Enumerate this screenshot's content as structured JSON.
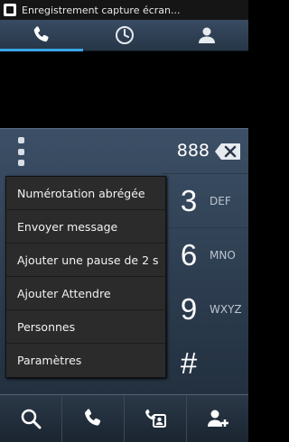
{
  "status_bar": {
    "notification_text": "Enregistrement capture écran..."
  },
  "tabs": [
    {
      "icon": "phone-icon",
      "active": true
    },
    {
      "icon": "clock-icon",
      "active": false
    },
    {
      "icon": "contact-icon",
      "active": false
    }
  ],
  "dialer": {
    "number": "888"
  },
  "menu": {
    "items": [
      "Numérotation abrégée",
      "Envoyer message",
      "Ajouter une pause de 2 s",
      "Ajouter Attendre",
      "Personnes",
      "Paramètres"
    ]
  },
  "keypad": {
    "keys": [
      {
        "num": "3",
        "letters": "DEF"
      },
      {
        "num": "6",
        "letters": "MNO"
      },
      {
        "num": "9",
        "letters": "WXYZ"
      },
      {
        "num": "#",
        "letters": ""
      }
    ]
  },
  "bottom_bar": {
    "icons": [
      "search-icon",
      "call-icon",
      "video-call-icon",
      "add-contact-icon"
    ]
  },
  "colors": {
    "accent": "#38a8ea",
    "panel_top": "#3c4f66",
    "panel_bottom": "#22303f"
  }
}
